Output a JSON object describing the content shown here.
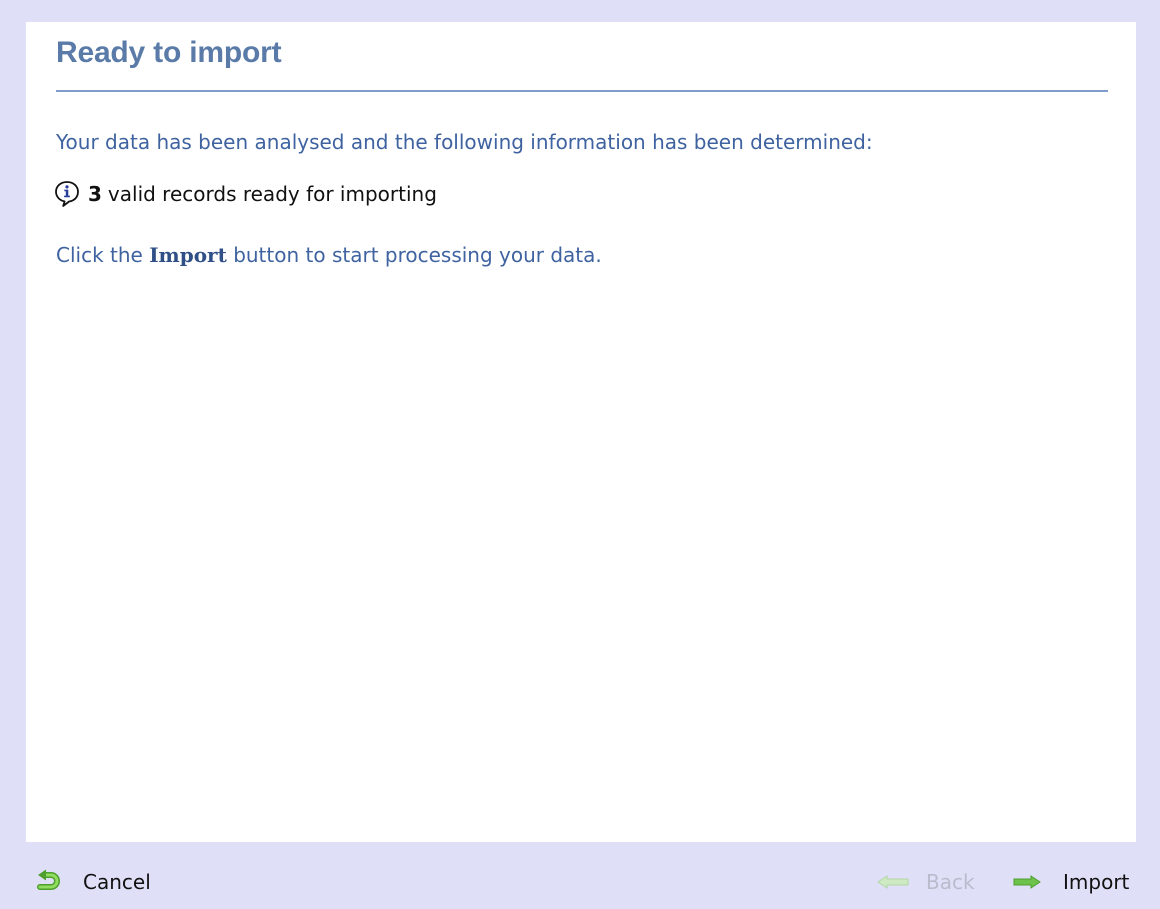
{
  "page": {
    "title": "Ready to import",
    "intro": "Your data has been analysed and the following information has been determined:",
    "result": {
      "count": "3",
      "text": "valid records ready for importing",
      "icon": "info-icon"
    },
    "instruction": {
      "prefix": "Click the",
      "emphasis": "Import",
      "suffix": "button to start processing your data."
    }
  },
  "footer": {
    "cancel_label": "Cancel",
    "cancel_icon": "return-arrow-icon",
    "back_label": "Back",
    "back_icon": "left-arrow-icon",
    "import_label": "Import",
    "import_icon": "right-arrow-icon"
  },
  "colors": {
    "background": "#dfe0f8",
    "panel": "#ffffff",
    "title": "#5a7ba8",
    "body_text": "#3f63a0",
    "disabled": "#b8bccc",
    "arrow_green": "#5fbf3f"
  }
}
